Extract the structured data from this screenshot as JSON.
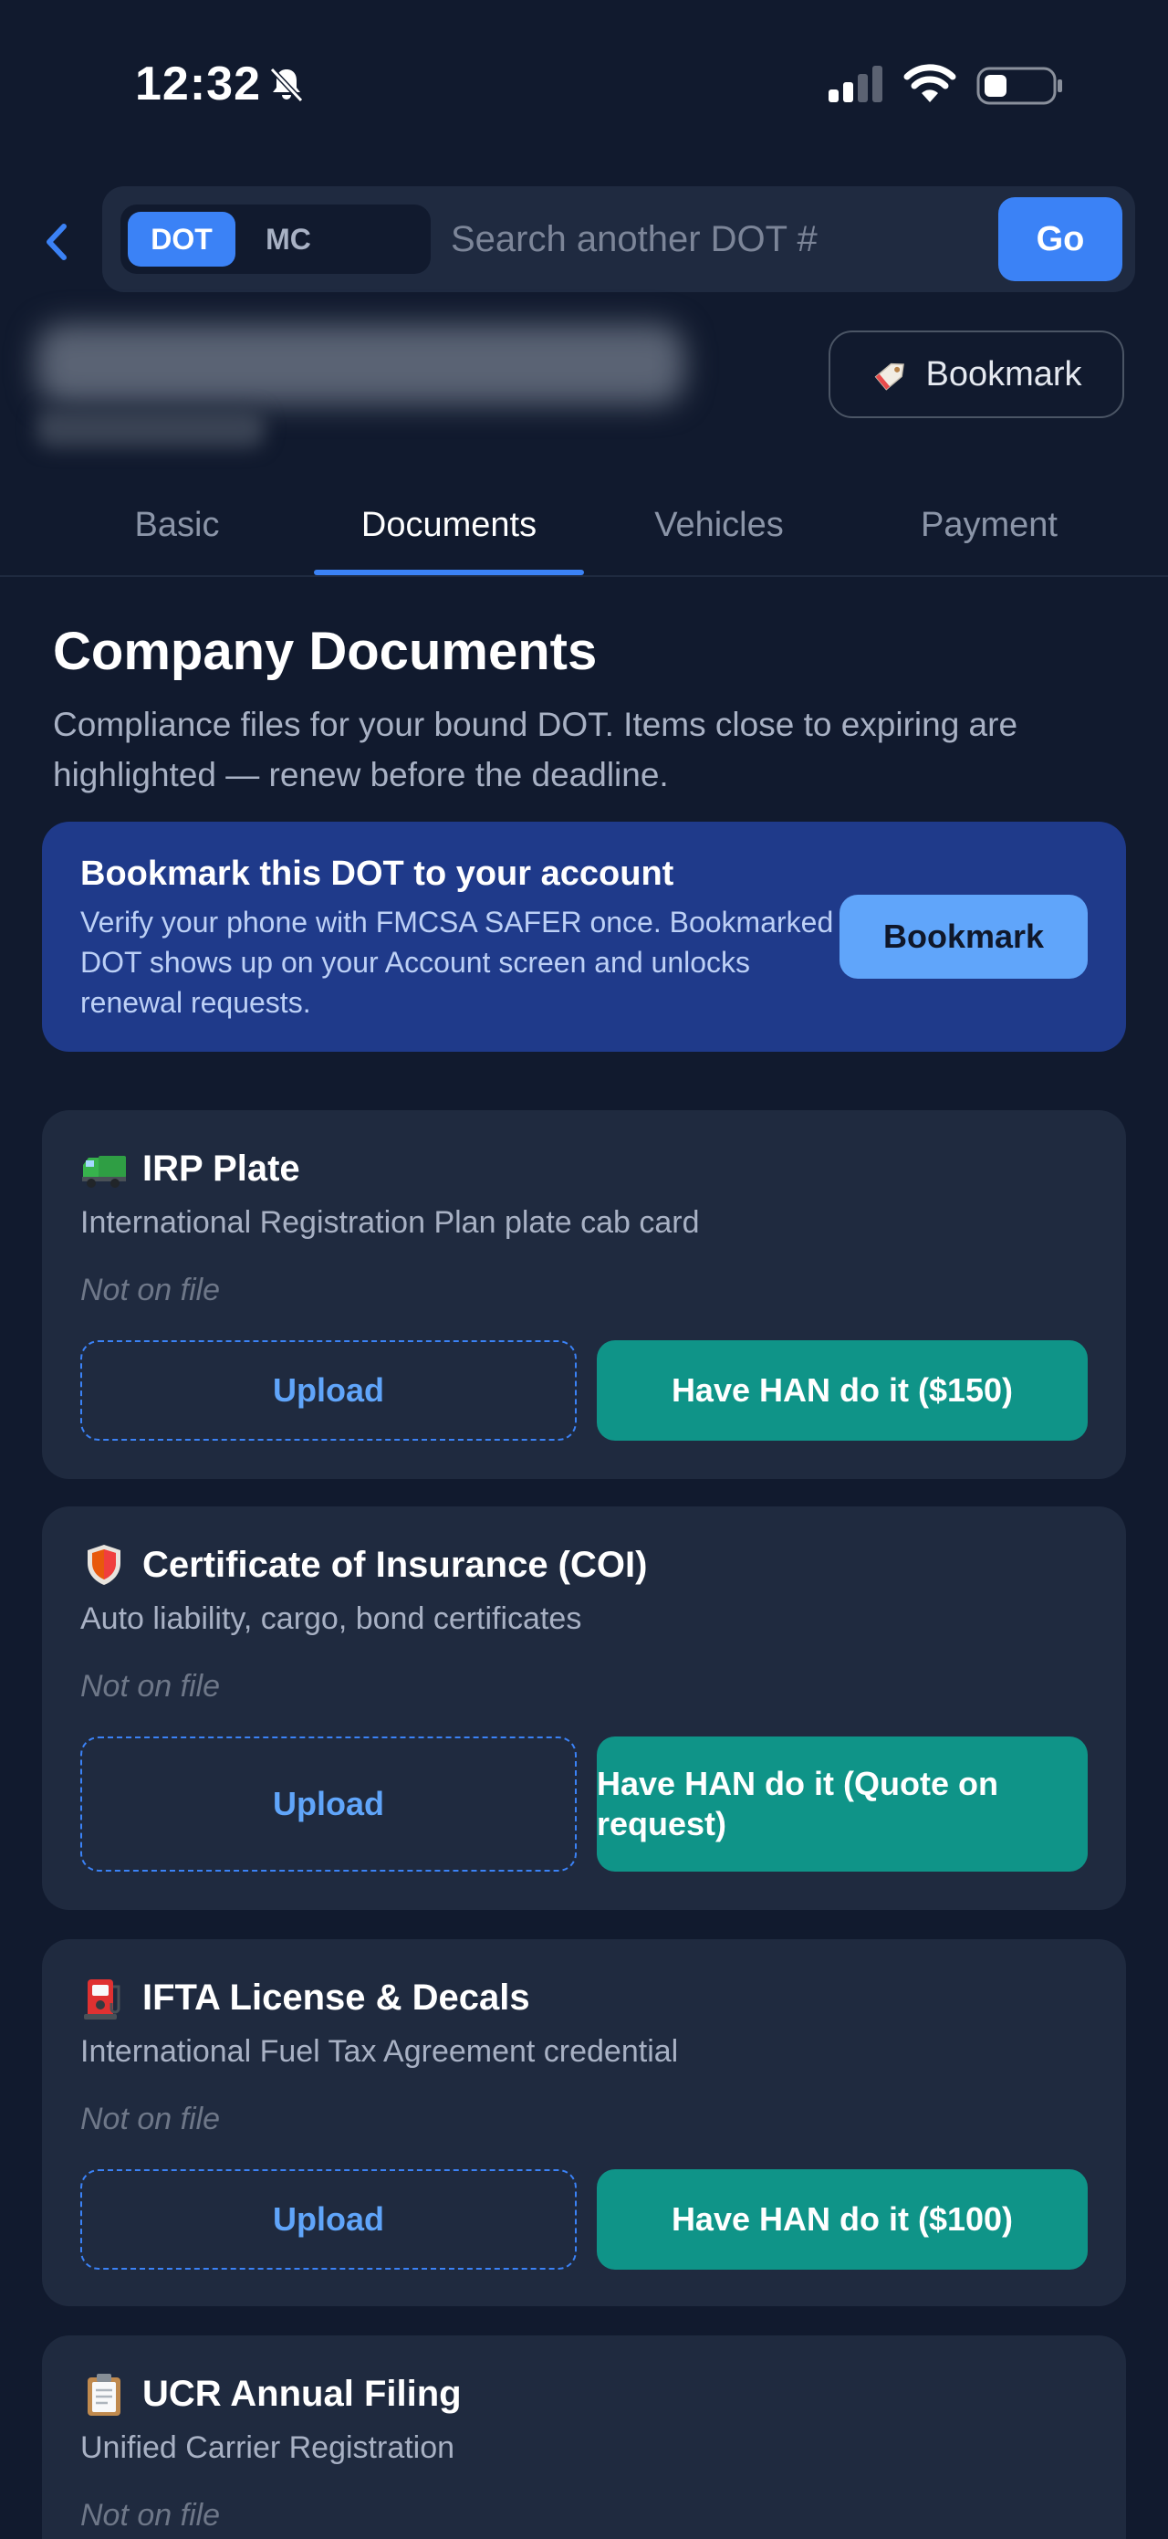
{
  "status_bar": {
    "time": "12:32"
  },
  "search": {
    "mode_dot": "DOT",
    "mode_mc": "MC",
    "placeholder": "Search another DOT #",
    "go_label": "Go"
  },
  "company": {
    "bookmark_label": "Bookmark"
  },
  "tabs": [
    {
      "label": "Basic"
    },
    {
      "label": "Documents"
    },
    {
      "label": "Vehicles"
    },
    {
      "label": "Payment"
    }
  ],
  "section": {
    "title": "Company Documents",
    "description": "Compliance files for your bound DOT. Items close to expiring are highlighted — renew before the deadline."
  },
  "promo": {
    "title": "Bookmark this DOT to your account",
    "text": "Verify your phone with FMCSA SAFER once. Bookmarked DOT shows up on your Account screen and unlocks renewal requests.",
    "button": "Bookmark"
  },
  "documents": [
    {
      "icon": "truck-icon",
      "title": "IRP Plate",
      "subtitle": "International Registration Plan plate cab card",
      "status": "Not on file",
      "upload_label": "Upload",
      "han_label": "Have HAN do it ($150)"
    },
    {
      "icon": "shield-icon",
      "title": "Certificate of Insurance (COI)",
      "subtitle": "Auto liability, cargo, bond certificates",
      "status": "Not on file",
      "upload_label": "Upload",
      "han_label": "Have HAN do it (Quote on request)"
    },
    {
      "icon": "fuel-pump-icon",
      "title": "IFTA License & Decals",
      "subtitle": "International Fuel Tax Agreement credential",
      "status": "Not on file",
      "upload_label": "Upload",
      "han_label": "Have HAN do it ($100)"
    },
    {
      "icon": "clipboard-icon",
      "title": "UCR Annual Filing",
      "subtitle": "Unified Carrier Registration",
      "status": "Not on file"
    }
  ]
}
